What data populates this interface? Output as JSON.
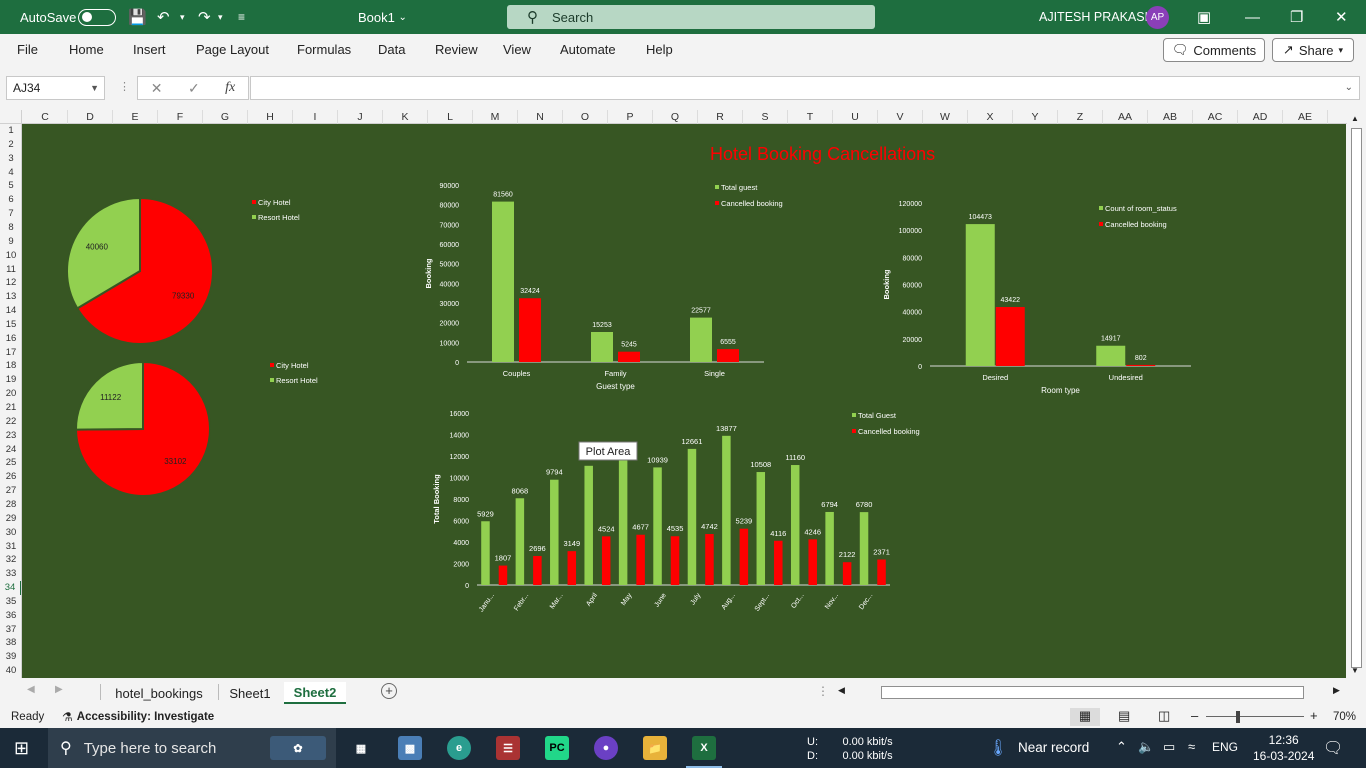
{
  "titlebar": {
    "autosave": "AutoSave",
    "book_title": "Book1",
    "search_placeholder": "Search",
    "user_name": "AJITESH PRAKASH",
    "user_initials": "AP"
  },
  "menu": {
    "items": [
      "File",
      "Home",
      "Insert",
      "Page Layout",
      "Formulas",
      "Data",
      "Review",
      "View",
      "Automate",
      "Help"
    ],
    "comments": "Comments",
    "share": "Share"
  },
  "formula_bar": {
    "name_box": "AJ34",
    "fx": "fx",
    "value": ""
  },
  "grid": {
    "columns": [
      "C",
      "D",
      "E",
      "F",
      "G",
      "H",
      "I",
      "J",
      "K",
      "L",
      "M",
      "N",
      "O",
      "P",
      "Q",
      "R",
      "S",
      "T",
      "U",
      "V",
      "W",
      "X",
      "Y",
      "Z",
      "AA",
      "AB",
      "AC",
      "AD",
      "AE"
    ],
    "rows": [
      "1",
      "2",
      "3",
      "4",
      "5",
      "6",
      "7",
      "8",
      "9",
      "10",
      "11",
      "12",
      "13",
      "14",
      "15",
      "16",
      "17",
      "18",
      "19",
      "20",
      "21",
      "22",
      "23",
      "24",
      "25",
      "26",
      "27",
      "28",
      "29",
      "30",
      "31",
      "32",
      "33",
      "34",
      "35",
      "36",
      "37",
      "38",
      "39",
      "40"
    ]
  },
  "dashboard_title": "Hotel Booking Cancellations",
  "tooltip": "Plot Area",
  "chart_data": [
    {
      "type": "pie",
      "categories": [
        "City Hotel",
        "Resort Hotel"
      ],
      "values": [
        79330,
        40060
      ],
      "colors": [
        "#ff0000",
        "#92d050"
      ],
      "legend": "right"
    },
    {
      "type": "pie",
      "categories": [
        "City Hotel",
        "Resort Hotel"
      ],
      "values": [
        33102,
        11122
      ],
      "colors": [
        "#ff0000",
        "#92d050"
      ],
      "legend": "right"
    },
    {
      "type": "bar",
      "categories": [
        "Couples",
        "Family",
        "Single"
      ],
      "series": [
        {
          "name": "Total guest",
          "values": [
            81560,
            15253,
            22577
          ],
          "color": "#92d050"
        },
        {
          "name": "Cancelled booking",
          "values": [
            32424,
            5245,
            6555
          ],
          "color": "#ff0000"
        }
      ],
      "xlabel": "Guest type",
      "ylabel": "Booking",
      "ylim": [
        0,
        90000
      ],
      "yticks": [
        "0",
        "10000",
        "20000",
        "30000",
        "40000",
        "50000",
        "60000",
        "70000",
        "80000",
        "90000"
      ],
      "legend": "top-right"
    },
    {
      "type": "bar",
      "categories": [
        "Desired",
        "Undesired"
      ],
      "series": [
        {
          "name": "Count of room_status",
          "values": [
            104473,
            14917
          ],
          "color": "#92d050"
        },
        {
          "name": "Cancelled booking",
          "values": [
            43422,
            802
          ],
          "color": "#ff0000"
        }
      ],
      "xlabel": "Room type",
      "ylabel": "Booking",
      "ylim": [
        0,
        120000
      ],
      "yticks": [
        "0",
        "20000",
        "40000",
        "60000",
        "80000",
        "100000",
        "120000"
      ],
      "legend": "top-right"
    },
    {
      "type": "bar",
      "categories": [
        "Janu...",
        "Febr...",
        "Mar...",
        "April",
        "May",
        "June",
        "July",
        "Aug...",
        "Sept...",
        "Oct...",
        "Nov...",
        "Dec..."
      ],
      "series": [
        {
          "name": "Total Guest",
          "values": [
            5929,
            8068,
            9794,
            11089,
            11791,
            10939,
            12661,
            13877,
            10508,
            11160,
            6794,
            6780
          ],
          "value_labels": [
            "5929",
            "8068",
            "9794",
            "",
            "",
            "10939",
            "12661",
            "13877",
            "10508",
            "11160",
            "6794",
            "6780"
          ],
          "color": "#92d050"
        },
        {
          "name": "Cancelled booking",
          "values": [
            1807,
            2696,
            3149,
            4524,
            4677,
            4535,
            4742,
            5239,
            4116,
            4246,
            2122,
            2371
          ],
          "value_labels": [
            "1807",
            "2696",
            "3149",
            "4524",
            "4677",
            "4535",
            "4742",
            "5239",
            "4116",
            "4246",
            "2122",
            "2371"
          ],
          "color": "#ff0000"
        }
      ],
      "xlabel": "",
      "ylabel": "Total Booking",
      "ylim": [
        0,
        16000
      ],
      "yticks": [
        "0",
        "2000",
        "4000",
        "6000",
        "8000",
        "10000",
        "12000",
        "14000",
        "16000"
      ],
      "legend": "top-right"
    }
  ],
  "sheet_tabs": {
    "tabs": [
      "hotel_bookings",
      "Sheet1",
      "Sheet2"
    ],
    "active": "Sheet2"
  },
  "status": {
    "ready": "Ready",
    "accessibility": "Accessibility: Investigate",
    "zoom": "70%"
  },
  "taskbar": {
    "search_placeholder": "Type here to search",
    "net_up_label": "U:",
    "net_down_label": "D:",
    "net_up": "0.00 kbit/s",
    "net_down": "0.00 kbit/s",
    "weather": "Near record",
    "lang": "ENG",
    "time": "12:36",
    "date": "16-03-2024"
  }
}
